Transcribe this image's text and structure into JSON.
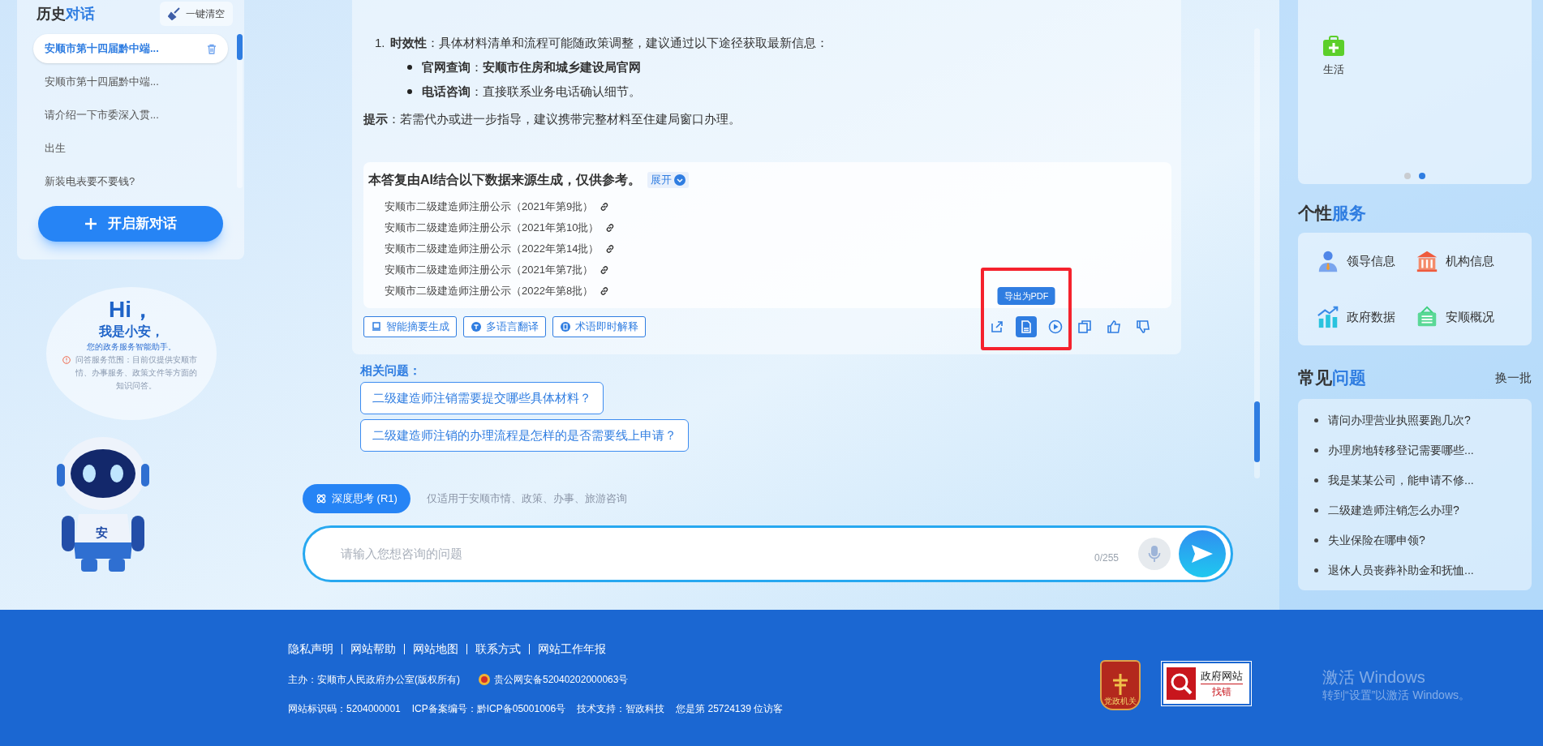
{
  "history": {
    "title_plain": "历史",
    "title_accent": "对话",
    "clear_button": "一键清空",
    "new_chat_button": "开启新对话",
    "items": [
      {
        "label": "安顺市第十四届黔中端...",
        "selected": true
      },
      {
        "label": "安顺市第十四届黔中端...",
        "selected": false
      },
      {
        "label": "请介绍一下市委深入贯...",
        "selected": false
      },
      {
        "label": "出生",
        "selected": false
      },
      {
        "label": "新装电表要不要钱?",
        "selected": false
      }
    ]
  },
  "assistant": {
    "greeting": "Hi，",
    "intro": "我是小安，",
    "tagline": "您的政务服务智能助手。",
    "scope": "问答服务范围：目前仅提供安顺市情、办事服务、政策文件等方面的知识问答。",
    "mascot_label": "安"
  },
  "answer": {
    "ordered_item": {
      "number": "1.",
      "text": "**时效性**：具体材料清单和流程可能随政策调整，建议通过以下途径获取最新信息："
    },
    "bullets": [
      "**官网查询**：**安顺市住房和城乡建设局官网**",
      "**电话咨询**：直接联系业务电话确认细节。"
    ],
    "tip": "**提示**：若需代办或进一步指导，建议携带完整材料至住建局窗口办理。"
  },
  "sources": {
    "heading": "本答复由AI结合以下数据来源生成，仅供参考。",
    "expand_button": "展开",
    "items": [
      "安顺市二级建造师注册公示（2021年第9批）",
      "安顺市二级建造师注册公示（2021年第10批）",
      "安顺市二级建造师注册公示（2022年第14批）",
      "安顺市二级建造师注册公示（2021年第7批）",
      "安顺市二级建造师注册公示（2022年第8批）"
    ]
  },
  "tools": [
    {
      "label": "智能摘要生成",
      "kind": "summary"
    },
    {
      "label": "多语言翻译",
      "kind": "translate"
    },
    {
      "label": "术语即时解释",
      "kind": "term"
    }
  ],
  "actions": {
    "tooltip": "导出为PDF",
    "items": [
      {
        "kind": "share",
        "selected": false
      },
      {
        "kind": "pdf",
        "selected": true
      },
      {
        "kind": "play",
        "selected": false
      },
      {
        "kind": "copy",
        "selected": false
      },
      {
        "kind": "like",
        "selected": false
      },
      {
        "kind": "dislike",
        "selected": false
      }
    ]
  },
  "related": {
    "title": "相关问题：",
    "questions": [
      "二级建造师注销需要提交哪些具体材料？",
      "二级建造师注销的办理流程是怎样的是否需要线上申请？"
    ]
  },
  "composer": {
    "deep_think_button": {
      "label": "深度思考 (R1)",
      "on": true
    },
    "scope_hint": "仅适用于安顺市情、政策、办事、旅游咨询",
    "placeholder": "请输入您想咨询的问题",
    "counter": "0/255"
  },
  "right": {
    "category_card": {
      "items": [
        {
          "label": "生活"
        }
      ],
      "pages": [
        {
          "selected": false
        },
        {
          "selected": true
        }
      ]
    },
    "services": {
      "title_plain": "个性",
      "title_accent": "服务",
      "items": [
        {
          "label": "领导信息",
          "kind": "person"
        },
        {
          "label": "机构信息",
          "kind": "building"
        },
        {
          "label": "政府数据",
          "kind": "chart"
        },
        {
          "label": "安顺概况",
          "kind": "board"
        }
      ]
    },
    "faq": {
      "title_plain": "常见",
      "title_accent": "问题",
      "refresh": "换一批",
      "items": [
        "请问办理营业执照要跑几次?",
        "办理房地转移登记需要哪些...",
        "我是某某公司，能申请不修...",
        "二级建造师注销怎么办理?",
        "失业保险在哪申领?",
        "退休人员丧葬补助金和抚恤..."
      ]
    }
  },
  "footer": {
    "links": [
      "隐私声明",
      "网站帮助",
      "网站地图",
      "联系方式",
      "网站工作年报"
    ],
    "sponsor": "主办：安顺市人民政府办公室(版权所有)",
    "police_record": "贵公网安备52040202000063号",
    "site_code": "网站标识码：5204000001",
    "icp": "ICP备案编号：黔ICP备05001006号",
    "support": "技术支持：智政科技",
    "visitors": "您是第 25724139 位访客",
    "badge_party": "党政机关",
    "badge_error": {
      "line1": "政府网站",
      "line2": "找错"
    }
  },
  "windows_activation": {
    "title": "激活 Windows",
    "subtitle": "转到“设置”以激活 Windows。"
  }
}
